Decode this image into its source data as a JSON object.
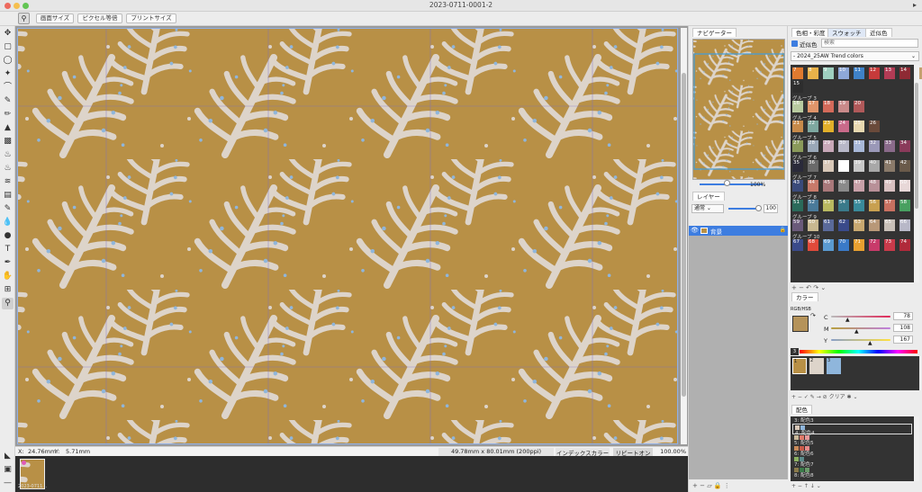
{
  "window": {
    "title": "2023-0711-0001-2"
  },
  "toolbar": {
    "btn_fit": "画面サイズ",
    "btn_pixel": "ピクセル等倍",
    "btn_print": "プリントサイズ"
  },
  "status": {
    "x_label": "X:",
    "x_value": "24.76mm",
    "y_label": "Y:",
    "y_value": "5.71mm",
    "doc_size": "49.78mm x 80.01mm (200ppi)",
    "color_mode": "インデックスカラー",
    "repeat": "リピートオン",
    "zoom": "100.00%"
  },
  "filmstrip": {
    "thumb_label": "2023-0711..."
  },
  "navigator": {
    "tab": "ナビゲーター",
    "zoom_pct": "100%"
  },
  "layers": {
    "tab": "レイヤー",
    "blend_mode": "通常",
    "opacity": "100",
    "layer_name": "背景"
  },
  "swatch_panel": {
    "tab_hue": "色相・彩度",
    "tab_swatch": "スウォッチ",
    "tab_near": "近似色",
    "near_check_label": "近似色",
    "search_placeholder": "検索",
    "set_name": "- 2024_25AW Trend colors",
    "rows": [
      {
        "group": "",
        "colors": [
          "#e07a2f",
          "#e9b24a",
          "#9fd0c0",
          "#8ea8d8",
          "#3f82c8",
          "#c73a3a",
          "#b33b55",
          "#8e2a34",
          "#c4a170",
          "#d9d2c0"
        ],
        "labels": [
          "7",
          "8",
          "9",
          "10",
          "11",
          "12",
          "13",
          "14"
        ]
      },
      {
        "group": "",
        "colors": [
          "#2d2d2d"
        ],
        "labels": [
          "15"
        ]
      },
      {
        "group": "グループ 3",
        "colors": [
          "#b8cba0",
          "#e0956a",
          "#d46a5a",
          "#c98a8a",
          "#b0595a"
        ],
        "labels": [
          "16",
          "17",
          "18",
          "19",
          "20"
        ]
      },
      {
        "group": "グループ 4",
        "colors": [
          "#c78a4a",
          "#7ea8a0",
          "#e2b02a",
          "#c96a8a",
          "#e8d9b0",
          "#6a4a3a"
        ],
        "labels": [
          "21",
          "22",
          "23",
          "24",
          "25",
          "26"
        ]
      },
      {
        "group": "グループ 5",
        "colors": [
          "#8a9a5a",
          "#9aa8b8",
          "#c8a8b8",
          "#b8b8c8",
          "#a8b8d8",
          "#9a98b8",
          "#8a6a8a",
          "#8a3a5a"
        ],
        "labels": [
          "27",
          "28",
          "29",
          "30",
          "31",
          "32",
          "33",
          "34"
        ]
      },
      {
        "group": "グループ 6",
        "colors": [
          "#2a2a3a",
          "#6a6a6a",
          "#d8c8b8",
          "#ffffff",
          "#c8c8c8",
          "#a8a8a8",
          "#8a7a6a",
          "#6a5a4a"
        ],
        "labels": [
          "35",
          "36",
          "37",
          "38",
          "39",
          "40",
          "41",
          "42"
        ]
      },
      {
        "group": "グループ 7",
        "colors": [
          "#3a4a7a",
          "#c87a6a",
          "#a8787a",
          "#8a8a8a",
          "#c8a0a8",
          "#b89098",
          "#d8c0c0",
          "#e8d8d8"
        ],
        "labels": [
          "43",
          "44",
          "45",
          "46",
          "47",
          "48",
          "49",
          "50"
        ]
      },
      {
        "group": "グループ 8",
        "colors": [
          "#2a6a5a",
          "#4a7a9a",
          "#b8b860",
          "#3a7a8a",
          "#3a8a9a",
          "#c8a050",
          "#c87060",
          "#48a060"
        ],
        "labels": [
          "51",
          "52",
          "53",
          "54",
          "55",
          "56",
          "57",
          "58"
        ]
      },
      {
        "group": "グループ 9",
        "colors": [
          "#6a5a7a",
          "#c8b890",
          "#5a6a9a",
          "#3a4a8a",
          "#c8a870",
          "#b89878",
          "#c8c0b8",
          "#b8b8c8"
        ],
        "labels": [
          "59",
          "60",
          "61",
          "62",
          "63",
          "64",
          "65",
          "66"
        ]
      },
      {
        "group": "グループ 10",
        "colors": [
          "#3a4a8a",
          "#e04a3a",
          "#5a9ad0",
          "#3a7ac8",
          "#e8a030",
          "#c83a6a",
          "#c83a4a",
          "#b02a3a"
        ],
        "labels": [
          "67",
          "68",
          "69",
          "70",
          "71",
          "72",
          "73",
          "74"
        ]
      }
    ]
  },
  "color_panel": {
    "tab": "カラー",
    "model": "RGB/HSB",
    "c_label": "C",
    "c_value": "78",
    "m_label": "M",
    "m_value": "108",
    "y_label": "Y",
    "y_value": "167",
    "main_color": "#b5935a",
    "slot_badge": "3",
    "history": [
      {
        "n": "1",
        "color": "#b89046"
      },
      {
        "n": "2",
        "color": "#ddd4ca"
      },
      {
        "n": "3",
        "color": "#8fb6dc"
      }
    ],
    "clear_label": "クリア"
  },
  "palette_panel": {
    "tab": "配色",
    "items": [
      {
        "label": "3: 配色3",
        "colors": []
      },
      {
        "label": "4: 配色4",
        "colors": [
          "#d8c8b8",
          "#8fb6dc"
        ]
      },
      {
        "label": "5: 配色5",
        "colors": [
          "#c9b89a",
          "#e07a6a",
          "#e89a9a"
        ]
      },
      {
        "label": "6: 配色6",
        "colors": [
          "#c88a5a",
          "#c85a4a",
          "#e88a8a"
        ]
      },
      {
        "label": "7: 配色7",
        "colors": [
          "#8ab060",
          "#5a8a8a"
        ]
      },
      {
        "label": "8: 配色8",
        "colors": [
          "#8a7a4a",
          "#3a7a4a",
          "#6a9a6a"
        ]
      }
    ]
  },
  "colors": {
    "canvas_bg": "#b89046",
    "leaf": "#ddd4ca",
    "dot": "#8fb6dc",
    "accent": "#3d7de0"
  }
}
